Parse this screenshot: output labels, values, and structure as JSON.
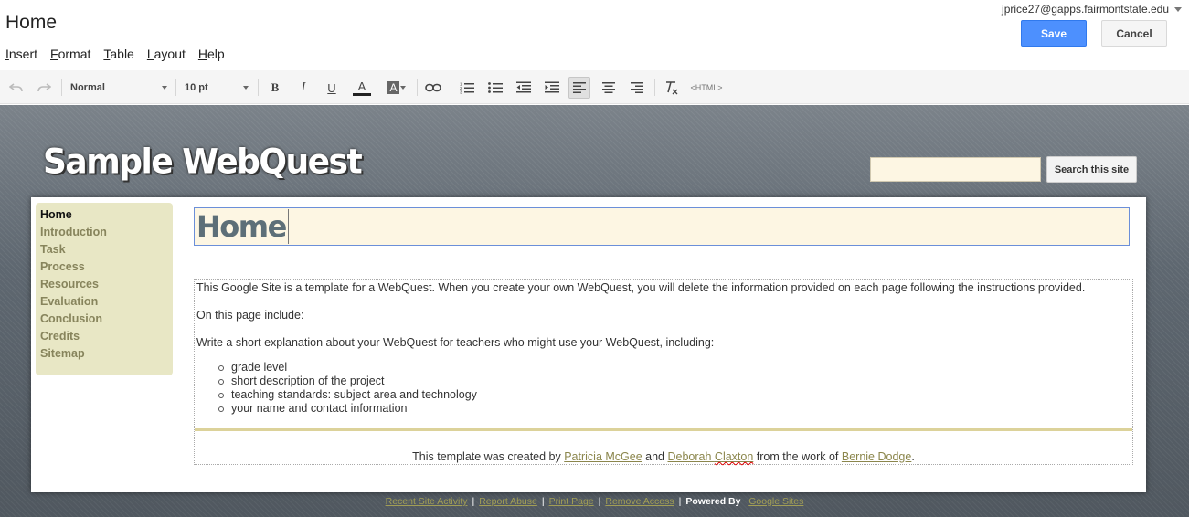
{
  "editor": {
    "page_title": "Home",
    "account_email": "jprice27@gapps.fairmontstate.edu",
    "save_label": "Save",
    "cancel_label": "Cancel",
    "menu": [
      {
        "first": "I",
        "rest": "nsert"
      },
      {
        "first": "F",
        "rest": "ormat"
      },
      {
        "first": "T",
        "rest": "able"
      },
      {
        "first": "L",
        "rest": "ayout"
      },
      {
        "first": "H",
        "rest": "elp"
      }
    ]
  },
  "toolbar": {
    "style_value": "Normal",
    "size_value": "10 pt",
    "html_label": "<HTML>",
    "icons": [
      "undo-icon",
      "redo-icon",
      "bold-icon",
      "italic-icon",
      "underline-icon",
      "text-color-icon",
      "highlight-color-icon",
      "link-icon",
      "numbered-list-icon",
      "bulleted-list-icon",
      "outdent-icon",
      "indent-icon",
      "align-left-icon",
      "align-center-icon",
      "align-right-icon",
      "clear-formatting-icon"
    ],
    "bold_label": "B",
    "italic_label": "I",
    "underline_label": "U",
    "text_color_label": "A",
    "highlight_label": "A"
  },
  "site": {
    "title": "Sample WebQuest",
    "search_button_label": "Search this site",
    "search_value": "",
    "nav": [
      {
        "label": "Home",
        "active": true
      },
      {
        "label": "Introduction"
      },
      {
        "label": "Task"
      },
      {
        "label": "Process"
      },
      {
        "label": "Resources"
      },
      {
        "label": "Evaluation"
      },
      {
        "label": "Conclusion"
      },
      {
        "label": "Credits"
      },
      {
        "label": "Sitemap"
      }
    ],
    "heading": "Home",
    "paragraphs": [
      "This Google Site is a template for a WebQuest. When you create your own WebQuest, you will delete the information provided on each page following the instructions provided.",
      "On this page include:",
      "Write a short explanation about your WebQuest for teachers who might use your WebQuest, including:"
    ],
    "bullets": [
      "grade level",
      "short description of the project",
      "teaching standards: subject area and technology",
      "your name and contact information"
    ],
    "credit": {
      "prefix": "This template was created by ",
      "author1": "Patricia McGee",
      "and": " and ",
      "author2": "Deborah Claxton",
      "middle": " from the work of ",
      "author3": "Bernie Dodge",
      "suffix": "."
    }
  },
  "footer": {
    "links": [
      "Recent Site Activity",
      "Report Abuse",
      "Print Page",
      "Remove Access"
    ],
    "separator": "|",
    "powered_by": "Powered By",
    "powered_link": "Google Sites"
  },
  "colors": {
    "save_blue": "#4d90fe",
    "nav_bg": "#e8e7c5",
    "link_olive": "#8b864c",
    "heading_bg": "#fdf6e3"
  }
}
